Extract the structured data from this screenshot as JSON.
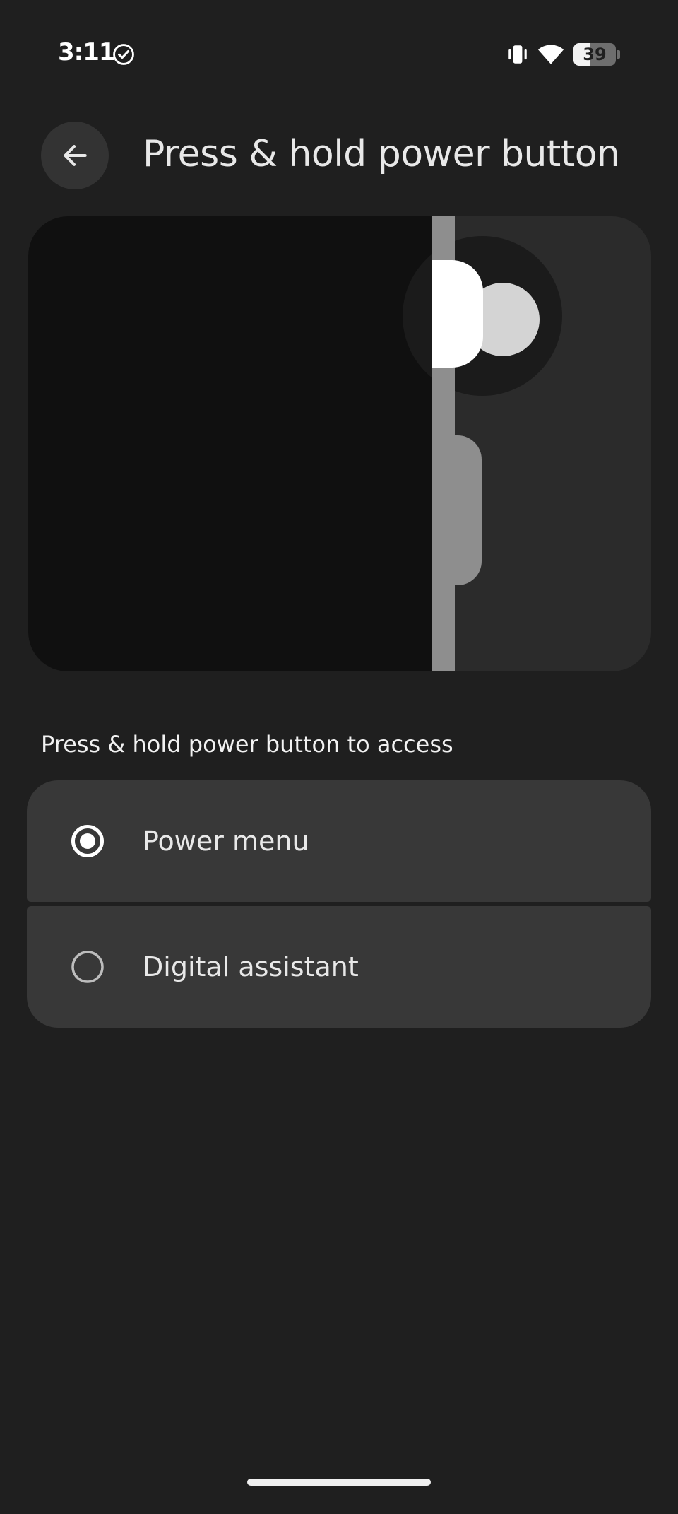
{
  "status_bar": {
    "time": "3:11",
    "battery_level": "39",
    "battery_percent": 39,
    "icons": [
      "check-circle-icon",
      "vibrate-icon",
      "wifi-icon",
      "battery-icon"
    ]
  },
  "header": {
    "back_icon": "arrow-left-icon",
    "title": "Press & hold power button"
  },
  "illustration": {
    "description_icon": "power-button-illustration"
  },
  "section": {
    "label": "Press & hold power button to access",
    "options": [
      {
        "label": "Power menu",
        "selected": true
      },
      {
        "label": "Digital assistant",
        "selected": false
      }
    ]
  },
  "colors": {
    "background": "#1f1f1f",
    "card": "#383838",
    "accent": "#ffffff"
  }
}
